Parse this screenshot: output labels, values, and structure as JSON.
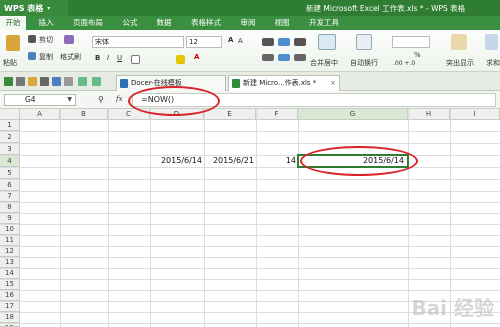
{
  "app": {
    "label": "WPS 表格",
    "caret": "▾"
  },
  "window_title": "新建 Microsoft Excel 工作表.xls * - WPS 表格",
  "menu": [
    "开始",
    "插入",
    "页面布局",
    "公式",
    "数据",
    "表格样式",
    "审阅",
    "视图",
    "开发工具"
  ],
  "menu_active": "开始",
  "ribbon": {
    "paste": "粘贴",
    "cut": "剪切",
    "copy": "复制",
    "format_painter": "格式刷",
    "font_name": "宋体",
    "font_size": "12",
    "merge_center": "合并居中",
    "wrap_text": "自动换行",
    "highlight": "突出显示",
    "more": "求和",
    "number_format": "%",
    "decimals": ".00 +.0"
  },
  "tabs": [
    {
      "label": "Docer-在线模板",
      "closable": true
    },
    {
      "label": "新建 Micro...作表.xls *",
      "closable": true
    }
  ],
  "formula_bar": {
    "cell_ref": "G4",
    "fx": "fx",
    "formula": "=NOW()"
  },
  "columns": [
    "A",
    "B",
    "C",
    "D",
    "E",
    "F",
    "G",
    "H",
    "I"
  ],
  "rows": [
    "1",
    "2",
    "3",
    "4",
    "5",
    "6",
    "7",
    "8",
    "9",
    "10",
    "11",
    "12",
    "13",
    "14",
    "15",
    "16",
    "17",
    "18",
    "19"
  ],
  "cells": {
    "D4": "2015/6/14",
    "E4": "2015/6/21",
    "F4": "14",
    "G4": "2015/6/14"
  },
  "watermark": "Bai 经验"
}
